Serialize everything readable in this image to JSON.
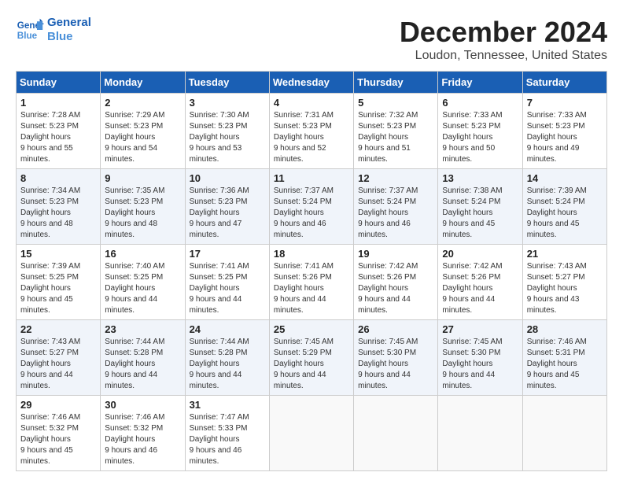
{
  "header": {
    "logo_line1": "General",
    "logo_line2": "Blue",
    "month": "December 2024",
    "location": "Loudon, Tennessee, United States"
  },
  "weekdays": [
    "Sunday",
    "Monday",
    "Tuesday",
    "Wednesday",
    "Thursday",
    "Friday",
    "Saturday"
  ],
  "weeks": [
    [
      {
        "day": "1",
        "sunrise": "7:28 AM",
        "sunset": "5:23 PM",
        "daylight": "9 hours and 55 minutes."
      },
      {
        "day": "2",
        "sunrise": "7:29 AM",
        "sunset": "5:23 PM",
        "daylight": "9 hours and 54 minutes."
      },
      {
        "day": "3",
        "sunrise": "7:30 AM",
        "sunset": "5:23 PM",
        "daylight": "9 hours and 53 minutes."
      },
      {
        "day": "4",
        "sunrise": "7:31 AM",
        "sunset": "5:23 PM",
        "daylight": "9 hours and 52 minutes."
      },
      {
        "day": "5",
        "sunrise": "7:32 AM",
        "sunset": "5:23 PM",
        "daylight": "9 hours and 51 minutes."
      },
      {
        "day": "6",
        "sunrise": "7:33 AM",
        "sunset": "5:23 PM",
        "daylight": "9 hours and 50 minutes."
      },
      {
        "day": "7",
        "sunrise": "7:33 AM",
        "sunset": "5:23 PM",
        "daylight": "9 hours and 49 minutes."
      }
    ],
    [
      {
        "day": "8",
        "sunrise": "7:34 AM",
        "sunset": "5:23 PM",
        "daylight": "9 hours and 48 minutes."
      },
      {
        "day": "9",
        "sunrise": "7:35 AM",
        "sunset": "5:23 PM",
        "daylight": "9 hours and 48 minutes."
      },
      {
        "day": "10",
        "sunrise": "7:36 AM",
        "sunset": "5:23 PM",
        "daylight": "9 hours and 47 minutes."
      },
      {
        "day": "11",
        "sunrise": "7:37 AM",
        "sunset": "5:24 PM",
        "daylight": "9 hours and 46 minutes."
      },
      {
        "day": "12",
        "sunrise": "7:37 AM",
        "sunset": "5:24 PM",
        "daylight": "9 hours and 46 minutes."
      },
      {
        "day": "13",
        "sunrise": "7:38 AM",
        "sunset": "5:24 PM",
        "daylight": "9 hours and 45 minutes."
      },
      {
        "day": "14",
        "sunrise": "7:39 AM",
        "sunset": "5:24 PM",
        "daylight": "9 hours and 45 minutes."
      }
    ],
    [
      {
        "day": "15",
        "sunrise": "7:39 AM",
        "sunset": "5:25 PM",
        "daylight": "9 hours and 45 minutes."
      },
      {
        "day": "16",
        "sunrise": "7:40 AM",
        "sunset": "5:25 PM",
        "daylight": "9 hours and 44 minutes."
      },
      {
        "day": "17",
        "sunrise": "7:41 AM",
        "sunset": "5:25 PM",
        "daylight": "9 hours and 44 minutes."
      },
      {
        "day": "18",
        "sunrise": "7:41 AM",
        "sunset": "5:26 PM",
        "daylight": "9 hours and 44 minutes."
      },
      {
        "day": "19",
        "sunrise": "7:42 AM",
        "sunset": "5:26 PM",
        "daylight": "9 hours and 44 minutes."
      },
      {
        "day": "20",
        "sunrise": "7:42 AM",
        "sunset": "5:26 PM",
        "daylight": "9 hours and 44 minutes."
      },
      {
        "day": "21",
        "sunrise": "7:43 AM",
        "sunset": "5:27 PM",
        "daylight": "9 hours and 43 minutes."
      }
    ],
    [
      {
        "day": "22",
        "sunrise": "7:43 AM",
        "sunset": "5:27 PM",
        "daylight": "9 hours and 44 minutes."
      },
      {
        "day": "23",
        "sunrise": "7:44 AM",
        "sunset": "5:28 PM",
        "daylight": "9 hours and 44 minutes."
      },
      {
        "day": "24",
        "sunrise": "7:44 AM",
        "sunset": "5:28 PM",
        "daylight": "9 hours and 44 minutes."
      },
      {
        "day": "25",
        "sunrise": "7:45 AM",
        "sunset": "5:29 PM",
        "daylight": "9 hours and 44 minutes."
      },
      {
        "day": "26",
        "sunrise": "7:45 AM",
        "sunset": "5:30 PM",
        "daylight": "9 hours and 44 minutes."
      },
      {
        "day": "27",
        "sunrise": "7:45 AM",
        "sunset": "5:30 PM",
        "daylight": "9 hours and 44 minutes."
      },
      {
        "day": "28",
        "sunrise": "7:46 AM",
        "sunset": "5:31 PM",
        "daylight": "9 hours and 45 minutes."
      }
    ],
    [
      {
        "day": "29",
        "sunrise": "7:46 AM",
        "sunset": "5:32 PM",
        "daylight": "9 hours and 45 minutes."
      },
      {
        "day": "30",
        "sunrise": "7:46 AM",
        "sunset": "5:32 PM",
        "daylight": "9 hours and 46 minutes."
      },
      {
        "day": "31",
        "sunrise": "7:47 AM",
        "sunset": "5:33 PM",
        "daylight": "9 hours and 46 minutes."
      },
      null,
      null,
      null,
      null
    ]
  ]
}
